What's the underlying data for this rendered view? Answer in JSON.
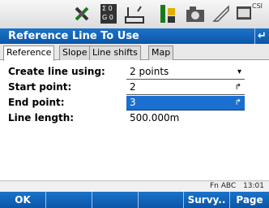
{
  "status": {
    "hint_a": "Σ 0",
    "hint_b": "G 0",
    "battery_label": "CSI"
  },
  "title": {
    "text": "Reference Line To Use",
    "back_glyph": "↵"
  },
  "tabs": [
    {
      "label": "Reference",
      "active": true
    },
    {
      "label": "Slope",
      "active": false
    },
    {
      "label": "Line shifts",
      "active": false
    },
    {
      "label": "Map",
      "active": false
    }
  ],
  "form": {
    "create_line_using": {
      "label": "Create line using:",
      "value": "2 points"
    },
    "start_point": {
      "label": "Start point:",
      "value": "2"
    },
    "end_point": {
      "label": "End point:",
      "value": "3"
    },
    "line_length": {
      "label": "Line length:",
      "value": "500.000m"
    }
  },
  "info": {
    "fn": "Fn",
    "mode": "ABC",
    "time": "13:01"
  },
  "softkeys": {
    "f1": "OK",
    "f2": "",
    "f3": "",
    "f4": "",
    "f5": "Survy..",
    "f6": "Page"
  },
  "colors": {
    "accent": "#0b56a8",
    "selection": "#1b6fd0"
  }
}
